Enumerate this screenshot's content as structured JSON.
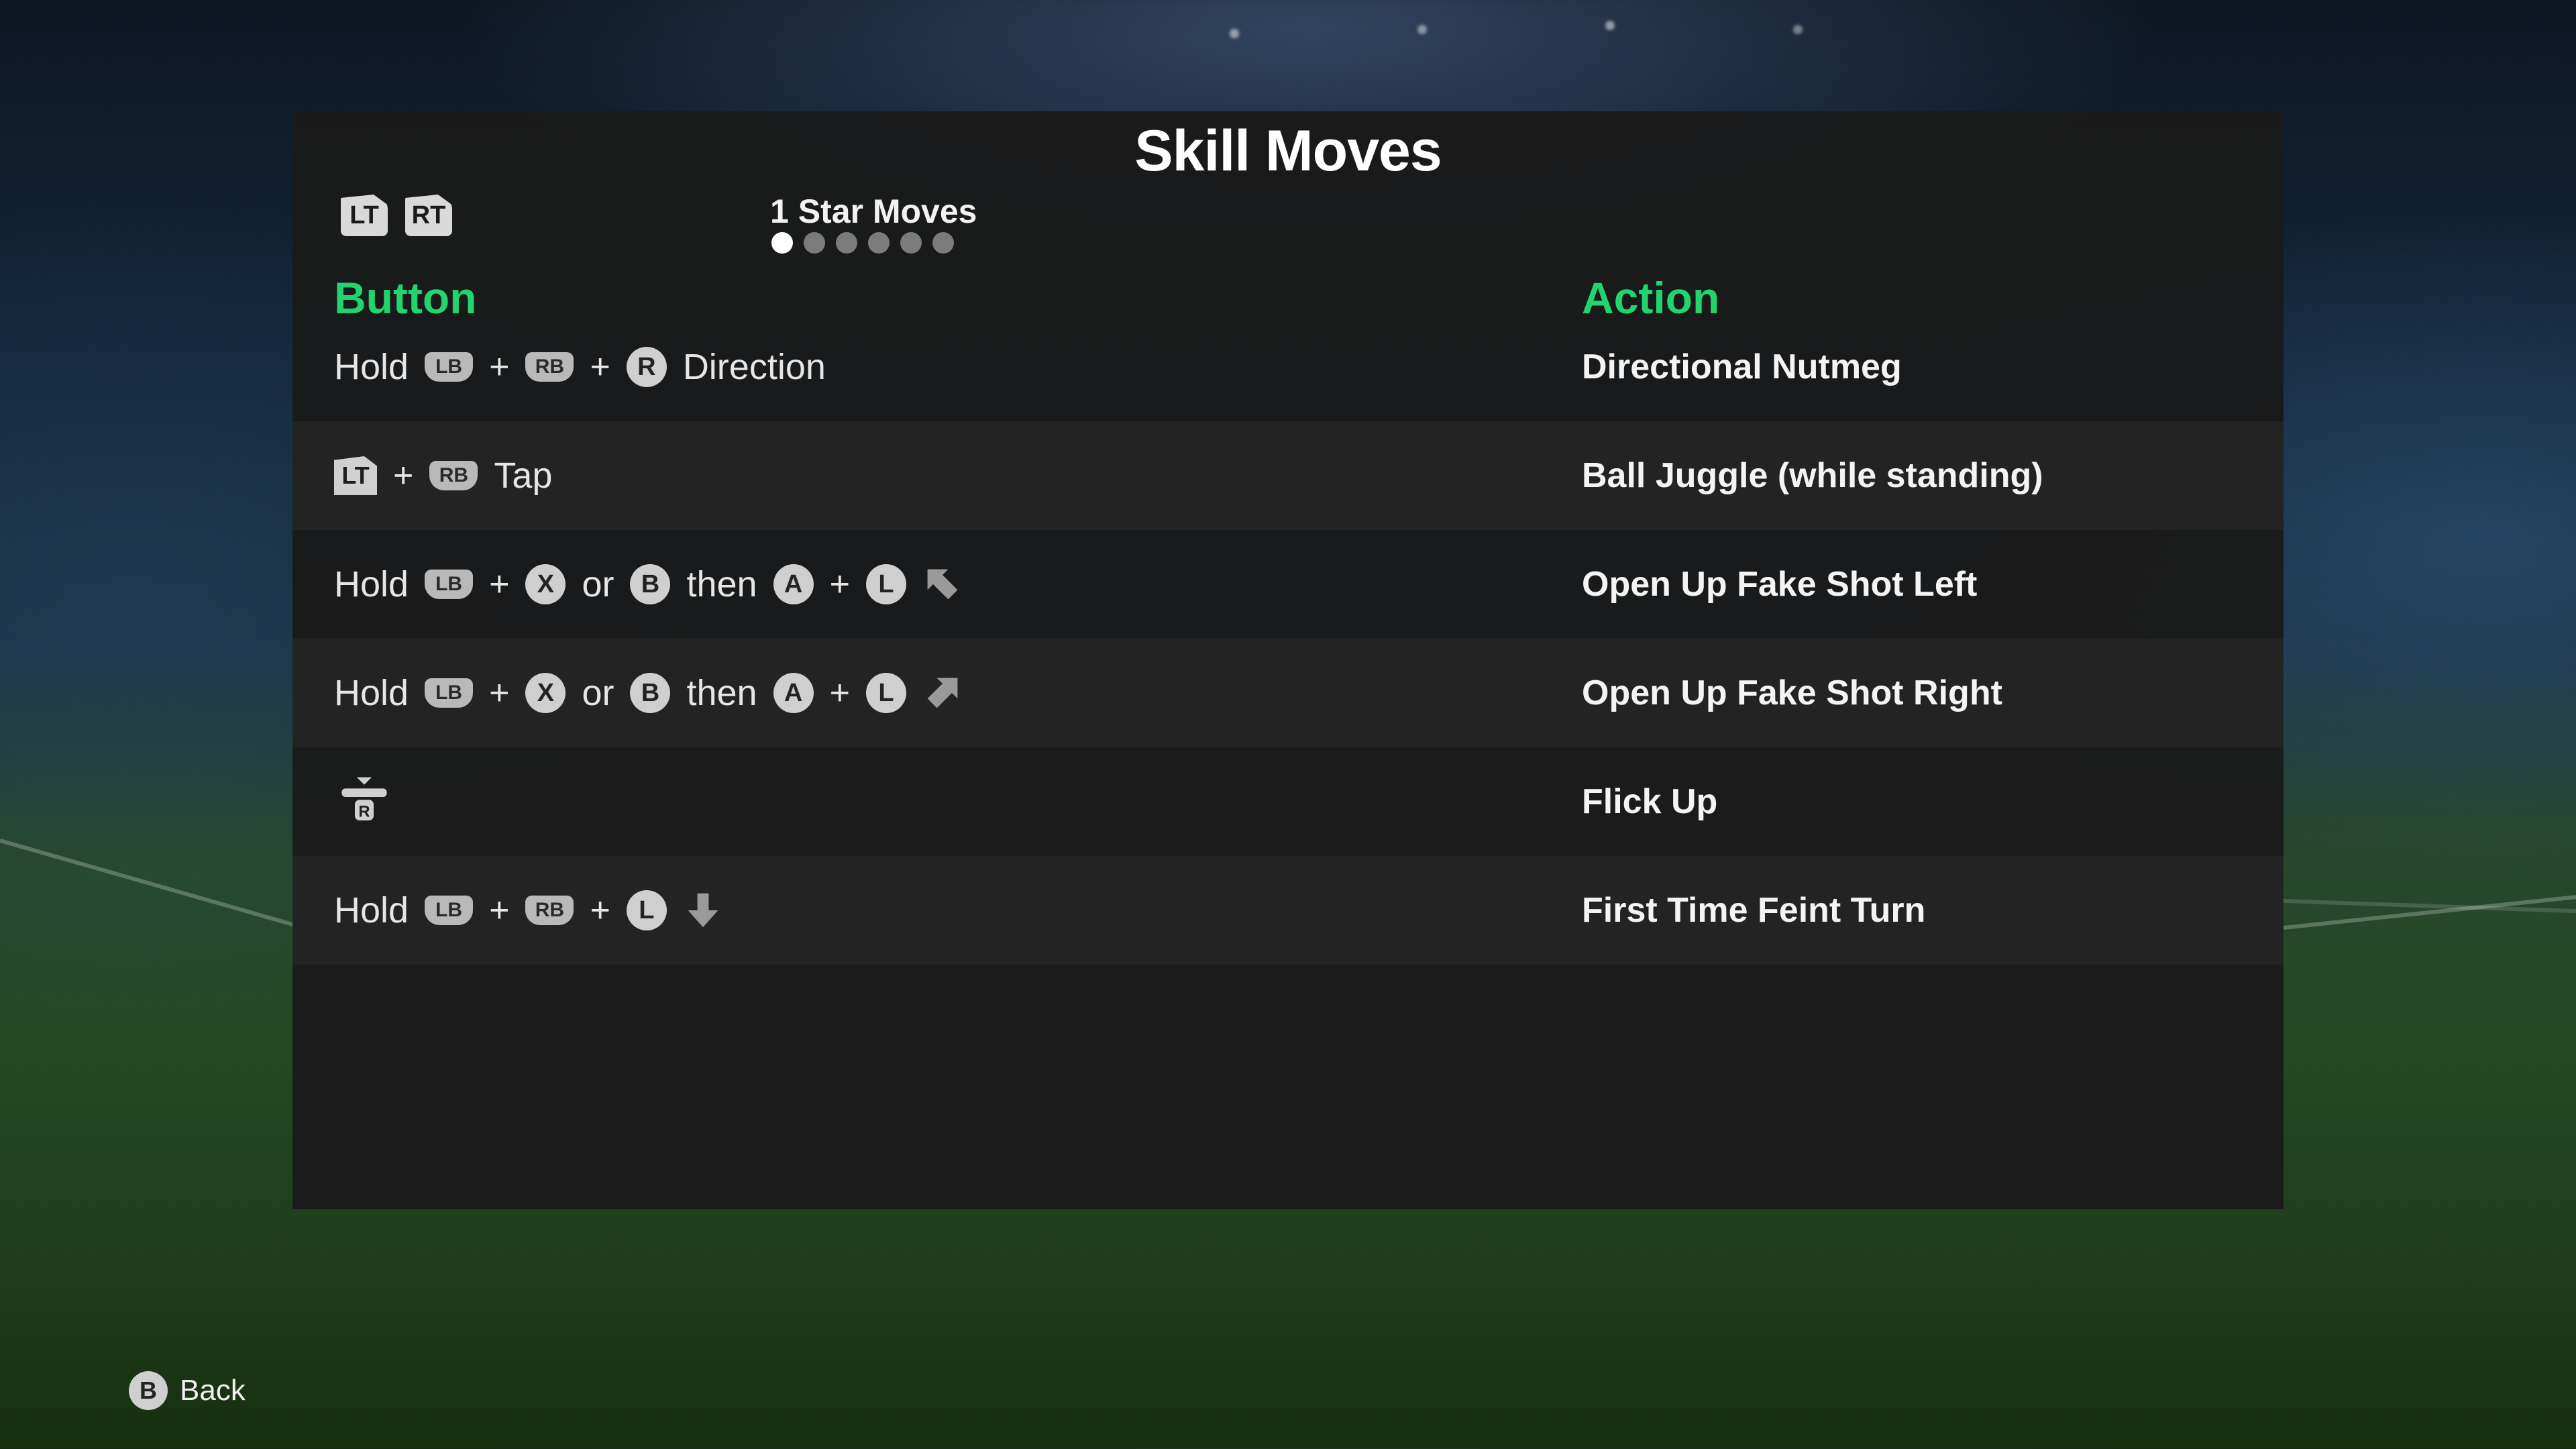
{
  "screen": {
    "title": "Skill Moves",
    "accent_color": "#22d46e",
    "panel_color": "#1a1a1a"
  },
  "pager": {
    "left_button": "LT",
    "right_button": "RT",
    "tier_label": "1 Star Moves",
    "total_pages": 6,
    "current_page": 1
  },
  "table": {
    "button_header": "Button",
    "action_header": "Action",
    "rows": [
      {
        "action": "Directional Nutmeg",
        "combo": [
          {
            "type": "word",
            "text": "Hold"
          },
          {
            "type": "bumper",
            "text": "LB"
          },
          {
            "type": "plus",
            "text": "+"
          },
          {
            "type": "bumper",
            "text": "RB"
          },
          {
            "type": "plus",
            "text": "+"
          },
          {
            "type": "circle",
            "text": "R"
          },
          {
            "type": "word",
            "text": "Direction"
          }
        ]
      },
      {
        "action": "Ball Juggle (while standing)",
        "combo": [
          {
            "type": "trigger",
            "text": "LT"
          },
          {
            "type": "plus",
            "text": "+"
          },
          {
            "type": "bumper",
            "text": "RB"
          },
          {
            "type": "word",
            "text": "Tap"
          }
        ]
      },
      {
        "action": "Open Up Fake Shot Left",
        "combo": [
          {
            "type": "word",
            "text": "Hold"
          },
          {
            "type": "bumper",
            "text": "LB"
          },
          {
            "type": "plus",
            "text": "+"
          },
          {
            "type": "circle",
            "text": "X"
          },
          {
            "type": "word",
            "text": "or"
          },
          {
            "type": "circle",
            "text": "B"
          },
          {
            "type": "word",
            "text": "then"
          },
          {
            "type": "circle",
            "text": "A"
          },
          {
            "type": "plus",
            "text": "+"
          },
          {
            "type": "circle",
            "text": "L"
          },
          {
            "type": "arrow",
            "icon": "arrow-up-left-icon"
          }
        ]
      },
      {
        "action": "Open Up Fake Shot Right",
        "combo": [
          {
            "type": "word",
            "text": "Hold"
          },
          {
            "type": "bumper",
            "text": "LB"
          },
          {
            "type": "plus",
            "text": "+"
          },
          {
            "type": "circle",
            "text": "X"
          },
          {
            "type": "word",
            "text": "or"
          },
          {
            "type": "circle",
            "text": "B"
          },
          {
            "type": "word",
            "text": "then"
          },
          {
            "type": "circle",
            "text": "A"
          },
          {
            "type": "plus",
            "text": "+"
          },
          {
            "type": "circle",
            "text": "L"
          },
          {
            "type": "arrow",
            "icon": "arrow-up-right-icon"
          }
        ]
      },
      {
        "action": "Flick Up",
        "combo": [
          {
            "type": "flick",
            "icon": "right-stick-flick-up-icon",
            "text": "R"
          }
        ]
      },
      {
        "action": "First Time Feint Turn",
        "combo": [
          {
            "type": "word",
            "text": "Hold"
          },
          {
            "type": "bumper",
            "text": "LB"
          },
          {
            "type": "plus",
            "text": "+"
          },
          {
            "type": "bumper",
            "text": "RB"
          },
          {
            "type": "plus",
            "text": "+"
          },
          {
            "type": "circle",
            "text": "L"
          },
          {
            "type": "arrow",
            "icon": "arrow-down-icon"
          }
        ]
      }
    ]
  },
  "footer": {
    "back_button": "B",
    "back_label": "Back"
  }
}
